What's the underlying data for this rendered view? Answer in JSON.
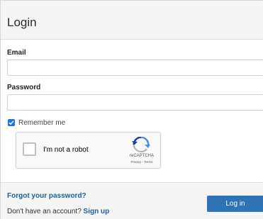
{
  "header": {
    "title": "Login"
  },
  "form": {
    "email_label": "Email",
    "email_value": "",
    "password_label": "Password",
    "password_value": "",
    "remember_label": "Remember me",
    "remember_checked": true
  },
  "recaptcha": {
    "label": "I'm not a robot",
    "brand": "reCAPTCHA",
    "links": "Privacy - Terms",
    "logo_icon": "recaptcha-logo-icon"
  },
  "footer": {
    "forgot_link": "Forgot your password?",
    "no_account_text": "Don't have an account?",
    "signup_link": "Sign up",
    "login_button": "Log in"
  },
  "colors": {
    "accent": "#2d73b5",
    "link": "#1f5f9c",
    "checkbox": "#1a73e8",
    "panel_bg": "#f5f5f5"
  }
}
